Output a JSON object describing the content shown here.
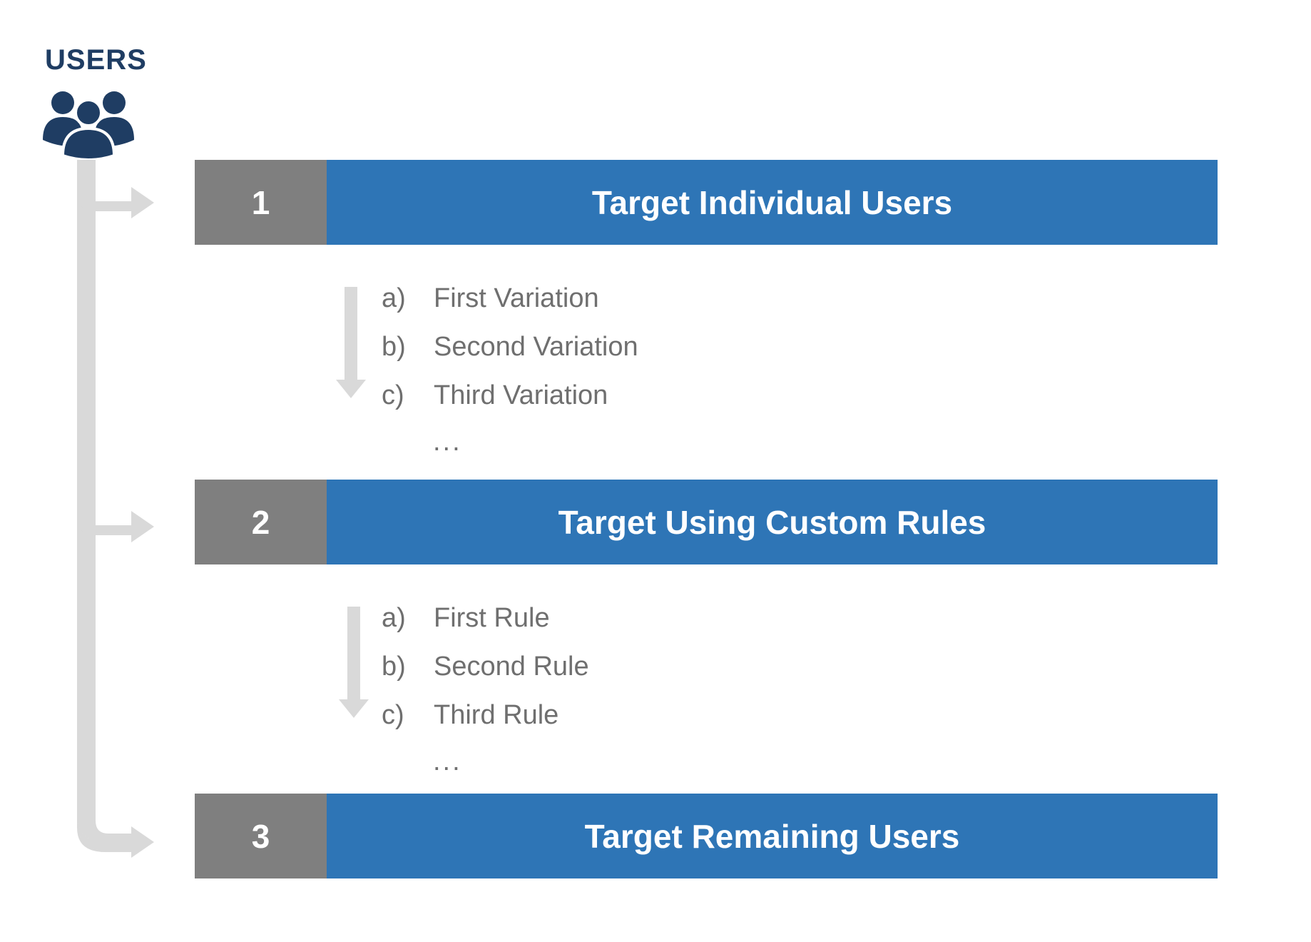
{
  "header": {
    "title": "USERS",
    "icon": "users-group-icon",
    "icon_color": "#1f3d63"
  },
  "colors": {
    "step_number_bg": "#7f7f7f",
    "step_title_bg": "#2e75b6",
    "connector": "#d9d9d9",
    "item_text": "#6f6f6f"
  },
  "steps": [
    {
      "number": "1",
      "title": "Target Individual Users",
      "items": [
        {
          "letter": "a)",
          "label": "First Variation"
        },
        {
          "letter": "b)",
          "label": "Second Variation"
        },
        {
          "letter": "c)",
          "label": "Third Variation"
        }
      ],
      "more": "..."
    },
    {
      "number": "2",
      "title": "Target Using Custom Rules",
      "items": [
        {
          "letter": "a)",
          "label": "First Rule"
        },
        {
          "letter": "b)",
          "label": "Second Rule"
        },
        {
          "letter": "c)",
          "label": "Third Rule"
        }
      ],
      "more": "..."
    },
    {
      "number": "3",
      "title": "Target Remaining Users"
    }
  ]
}
